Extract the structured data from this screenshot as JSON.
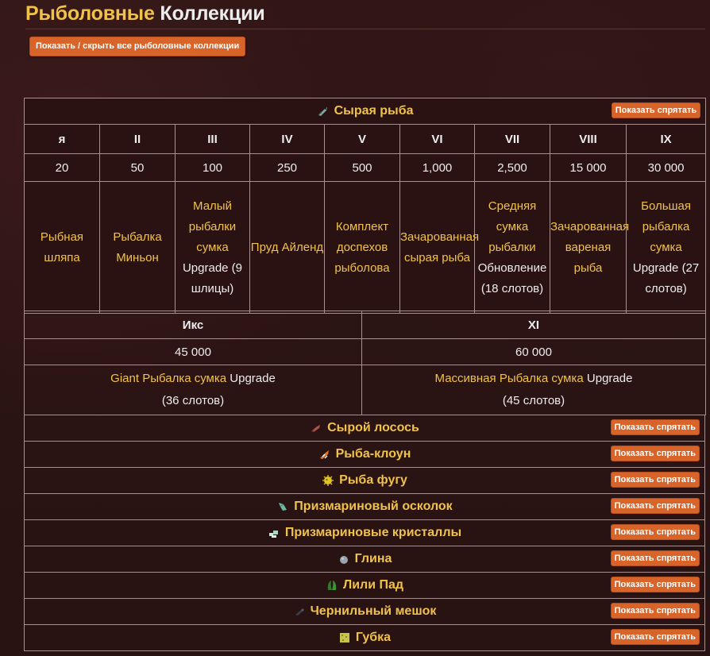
{
  "header": {
    "title_part1": "Рыболовные",
    "title_part2": "Коллекции",
    "toggle_all_label": "Показать / скрыть все рыболовные коллекции"
  },
  "raw_fish": {
    "title": "Сырая рыба",
    "icon": "raw-fish-icon",
    "show_hide_label": "Показать спрятать",
    "tiers": [
      "я",
      "II",
      "III",
      "IV",
      "V",
      "VI",
      "VII",
      "VIII",
      "IX"
    ],
    "amounts": [
      "20",
      "50",
      "100",
      "250",
      "500",
      "1,000",
      "2,500",
      "15 000",
      "30 000"
    ],
    "rewards": [
      {
        "gold": "Рыбная шляпа",
        "white": ""
      },
      {
        "gold": "Рыбалка Миньон",
        "white": ""
      },
      {
        "gold": "Малый рыбалки сумка",
        "white": "Upgrade (9 шлицы)"
      },
      {
        "gold": "Пруд Айленд",
        "white": ""
      },
      {
        "gold": "Комплект доспехов рыболова",
        "white": ""
      },
      {
        "gold": "Зачарованная сырая рыба",
        "white": ""
      },
      {
        "gold": "Средняя сумка рыбалки",
        "white": "Обновление (18 слотов)"
      },
      {
        "gold": "Зачарованная вареная рыба",
        "white": ""
      },
      {
        "gold": "Большая рыбалка сумка",
        "white": "Upgrade (27 слотов)"
      }
    ],
    "extra_tiers": [
      "Икс",
      "XI"
    ],
    "extra_amounts": [
      "45 000",
      "60 000"
    ],
    "extra_rewards": [
      {
        "gold": "Giant Рыбалка сумка",
        "white": "Upgrade",
        "slots": "(36 слотов)"
      },
      {
        "gold": "Массивная Рыбалка сумка",
        "white": "Upgrade",
        "slots": "(45 слотов)"
      }
    ]
  },
  "categories": [
    {
      "label": "Сырой лосось",
      "icon": "raw-salmon-icon",
      "button": "Показать спрятать"
    },
    {
      "label": "Рыба-клоун",
      "icon": "clownfish-icon",
      "button": "Показать спрятать"
    },
    {
      "label": "Рыба фугу",
      "icon": "pufferfish-icon",
      "button": "Показать спрятать"
    },
    {
      "label": "Призмариновый осколок",
      "icon": "prismarine-shard-icon",
      "button": "Показать спрятать"
    },
    {
      "label": "Призмариновые кристаллы",
      "icon": "prismarine-crystals-icon",
      "button": "Показать спрятать"
    },
    {
      "label": "Глина",
      "icon": "clay-icon",
      "button": "Показать спрятать"
    },
    {
      "label": "Лили Пад",
      "icon": "lily-pad-icon",
      "button": "Показать спрятать"
    },
    {
      "label": "Чернильный мешок",
      "icon": "ink-sac-icon",
      "button": "Показать спрятать"
    },
    {
      "label": "Губка",
      "icon": "sponge-icon",
      "button": "Показать спрятать"
    }
  ],
  "colors": {
    "accent_gold": "#f0c24a",
    "button_orange": "#d9642a",
    "background": "#2b1414",
    "border": "#a89090"
  }
}
